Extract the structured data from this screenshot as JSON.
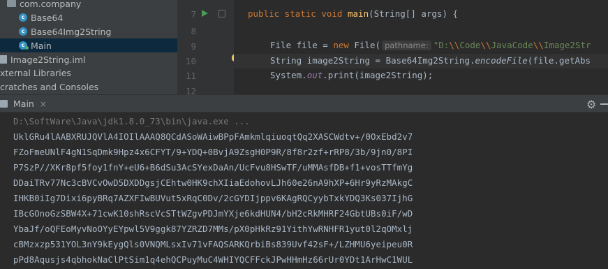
{
  "project_tree": {
    "items": [
      {
        "label": "com.company",
        "icon": "folder-icon"
      },
      {
        "label": "Base64",
        "icon": "class-icon"
      },
      {
        "label": "Base64Img2String",
        "icon": "class-icon"
      },
      {
        "label": "Main",
        "icon": "class-icon",
        "selected": true
      },
      {
        "label": "Image2String.iml",
        "icon": "file-icon"
      },
      {
        "label": "xternal Libraries",
        "icon": ""
      },
      {
        "label": "cratches and Consoles",
        "icon": ""
      }
    ]
  },
  "editor": {
    "line_numbers": [
      "7",
      "8",
      "9",
      "10",
      "11",
      "12"
    ],
    "line7": {
      "kw": "public static void ",
      "fn": "main",
      "rest": "(String[] args) {"
    },
    "line9": {
      "type": "File file = ",
      "kw": "new ",
      "cls": "File(",
      "hint": "pathname:",
      "str": "\"D:",
      "esc1": "\\\\",
      "str2": "Code",
      "esc2": "\\\\",
      "str3": "JavaCode",
      "esc3": "\\\\",
      "str4": "Image2Str"
    },
    "line10": {
      "a": "String image2String = Base64Img2String.",
      "it": "encodeFile",
      "b": "(file.getAbs"
    },
    "line11": {
      "a": "System.",
      "out": "out",
      "b": ".print(image2String);"
    }
  },
  "run_panel": {
    "tab_label": "Main",
    "close": "×"
  },
  "console": {
    "command": "D:\\SoftWare\\Java\\jdk1.8.0_73\\bin\\java.exe ...",
    "lines": [
      "UklGRu4lAABXRUJQVlA4IOIlAAAQ8QCdASoWAiwBPpFAmkmlqiuoqtQq2XASCWdtv+/0OxEbd2v7",
      "FZoFmeUNlF4gN1SqDmk9Hpz4x6CFYT/9+YDQ+0BvjA9ZsgH0P9R/8f8r2zf+rRP8/3b/9jn0/8PI",
      "P7SzP//XKr8pf5foy1fnY+eU6+B6dSu3AcSYexDaAn/UcFvu8HSwTF/uMMAsfDB+f1+vosTTfmYg",
      "DDaiTRv77Nc3cBVCvOwD5DXDDgsjCEhtw0HK9chXIiaEdohovLJh60e26nA9hXP+6Hr9yRzMAkgC",
      "IHKB0iIg7Dixi6pyBRq7AZXFIwBUVut5xRqC0Dv/2cGYDIjppv6KAgRQCyybTxkYDQ3Ks037IjhG",
      "IBcGOnoGzSBW4X+71cwK10shRscVcSTtWZgvPDJmYXje6kdHUN4/bH2cRkMHRF24GbtUBs0iF/wD",
      "YbaJf/oQFEoMyvNoOYyEYpwl5V9ggk87YZRZD7MMs/pX0pHkRz91YithYwRNHFR1yut0l2qOMxlj",
      "cBMzxzp531YOL3nY9kEygQls0VNQMLsxIv71vFAQSARKQrbiBs839Uvf42sF+/LZHMU6yeipeu0R",
      "pPd8Aqusjs4qbhokNaClPtSim1q4ehQCPuyMuC4WHIYQCFFckJPwHHmHz66rUr0YDt1ArHwC1WUL"
    ]
  }
}
